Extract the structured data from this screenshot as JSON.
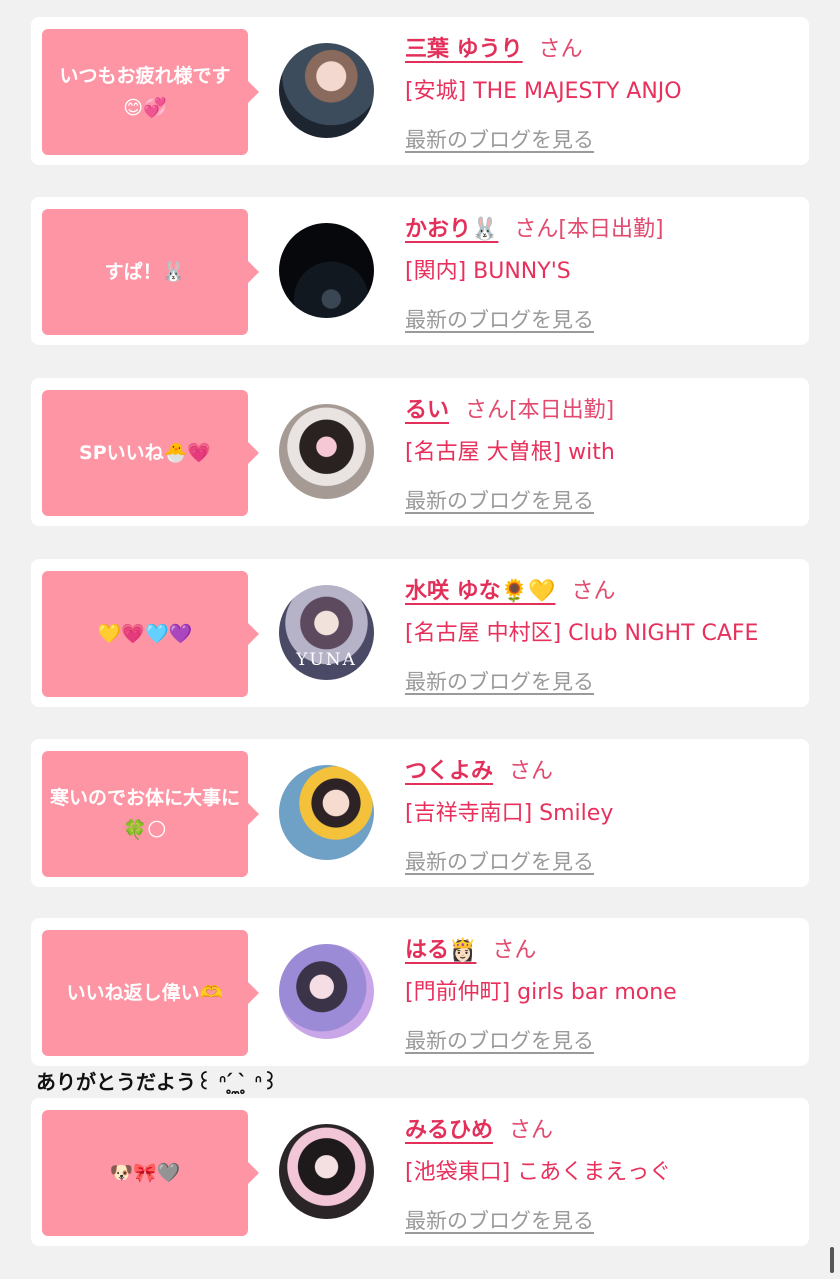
{
  "cards": [
    {
      "message": "いつもお疲れ様です😊💞",
      "name": "三葉 ゆうり",
      "suffix": "さん",
      "shop": "[安城] THE MAJESTY ANJO",
      "blog_link": "最新のブログを見る"
    },
    {
      "message": "すぱ！🐰",
      "name": "かおり🐰",
      "suffix": "さん[本日出勤]",
      "shop": "[関内] BUNNY'S",
      "blog_link": "最新のブログを見る"
    },
    {
      "message": "SPいいね🐣💗",
      "name": "るい",
      "suffix": "さん[本日出勤]",
      "shop": "[名古屋 大曽根] with",
      "blog_link": "最新のブログを見る"
    },
    {
      "message": "💛💗🩵💜",
      "name": "水咲 ゆな🌻💛",
      "suffix": "さん",
      "shop": "[名古屋 中村区] Club NIGHT CAFE",
      "blog_link": "最新のブログを見る",
      "avatar_text": "YUNA"
    },
    {
      "message": "寒いのでお体に大事に🍀🌕",
      "name": "つくよみ",
      "suffix": "さん",
      "shop": "[吉祥寺南口] Smiley",
      "blog_link": "最新のブログを見る"
    },
    {
      "message": "いいね返し偉い🫶",
      "name": "はる👸🏻",
      "suffix": "さん",
      "shop": "[門前仲町] girls bar mone",
      "blog_link": "最新のブログを見る"
    },
    {
      "message": "🐶🎀🩶",
      "name": "みるひめ",
      "suffix": "さん",
      "shop": "[池袋東口] こあくまえっぐ",
      "blog_link": "最新のブログを見る"
    }
  ],
  "inline_message": "ありがとうだよう꒰ ᐢ ̥́ ̼ ̥̀ ᐢ꒱",
  "colors": {
    "bubble": "#fe95a5",
    "name": "#e2305a",
    "shop": "#e8305c",
    "link": "#9a9a9a",
    "background": "#f1f1f1"
  }
}
